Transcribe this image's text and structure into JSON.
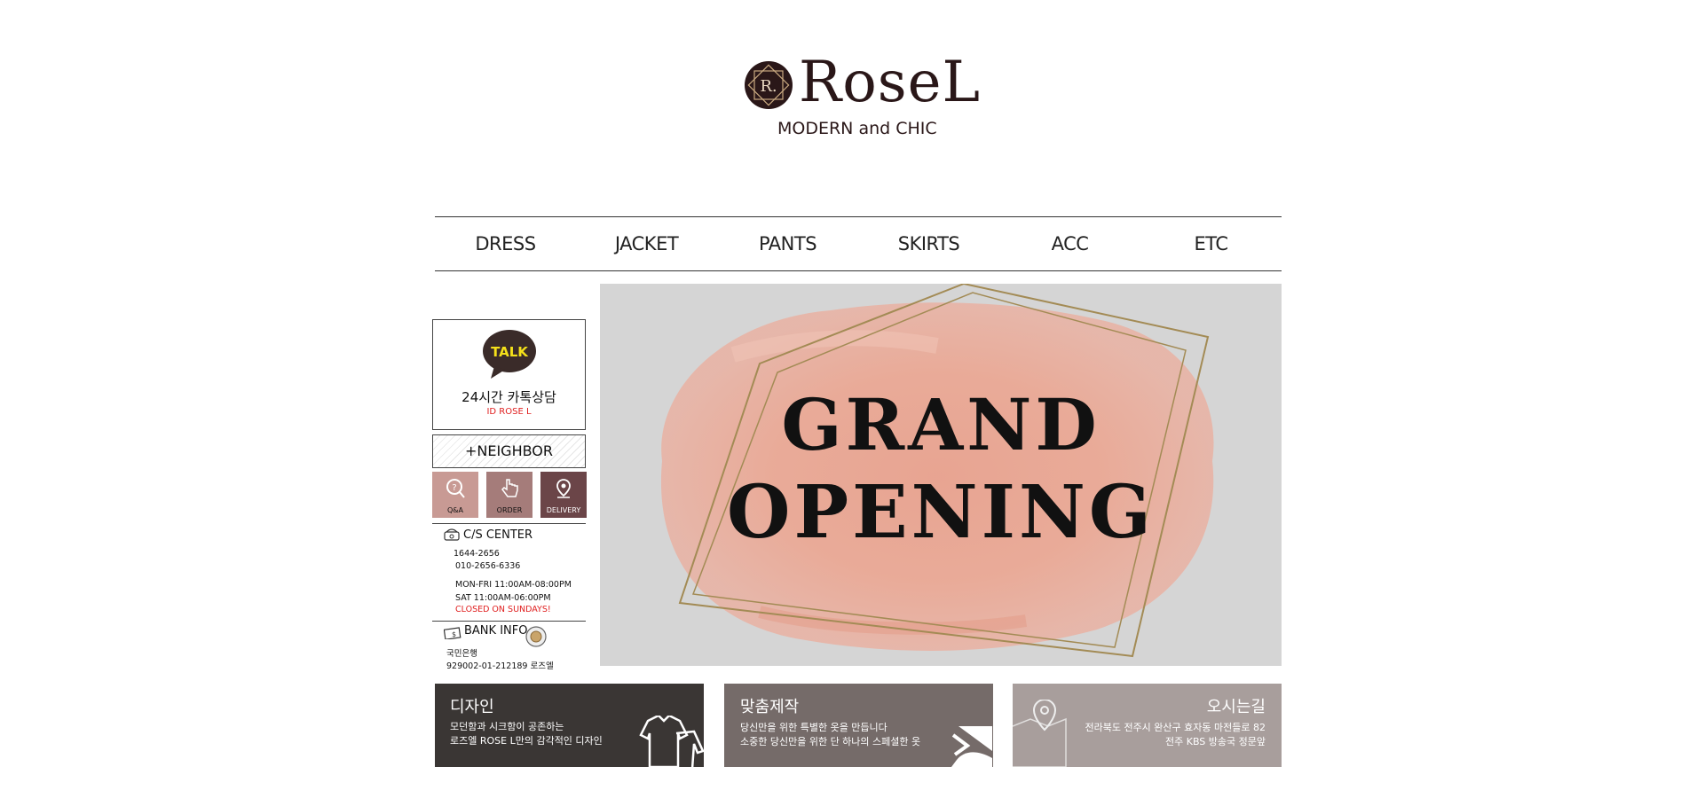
{
  "brand": {
    "logo_mark": "R.",
    "name": "RoseL",
    "tagline": "MODERN and CHIC"
  },
  "nav": [
    {
      "label": "DRESS"
    },
    {
      "label": "JACKET"
    },
    {
      "label": "PANTS"
    },
    {
      "label": "SKIRTS"
    },
    {
      "label": "ACC"
    },
    {
      "label": "ETC"
    }
  ],
  "talk": {
    "badge": "TALK",
    "title": "24시간 카톡상담",
    "id": "ID ROSE L"
  },
  "neighbor": {
    "label": "+NEIGHBOR"
  },
  "quick_buttons": [
    {
      "label": "Q&A",
      "color": "#c89a94"
    },
    {
      "label": "ORDER",
      "color": "#a57c7a"
    },
    {
      "label": "DELIVERY",
      "color": "#6b4548"
    }
  ],
  "cs": {
    "title": "C/S CENTER",
    "phone1": "1644-2656",
    "phone2": "010-2656-6336",
    "hours1": "MON-FRI 11:00AM-08:00PM",
    "hours2": "SAT 11:00AM-06:00PM",
    "closed": "CLOSED ON SUNDAYS!"
  },
  "bank": {
    "title": "BANK INFO",
    "bank_name": "국민은행",
    "account": "929002-01-212189 로즈엘"
  },
  "banner": {
    "line1": "GRAND",
    "line2": "OPENING"
  },
  "cards": [
    {
      "title": "디자인",
      "line1": "모던함과 시크함이 공존하는",
      "line2": "로즈엘 ROSE L만의 감각적인 디자인",
      "color": "#3a3634"
    },
    {
      "title": "맞춤제작",
      "line1": "당신만을 위한 특별한 옷을 만듭니다",
      "line2": "소중한 당신만을 위한 단 하나의 스페셜한 옷",
      "color": "#756b69"
    },
    {
      "title": "오시는길",
      "line1": "전라북도 전주시 완산구 효자동 마전들로 82",
      "line2": "전주 KBS 방송국 정문앞",
      "color": "#a89e9c"
    }
  ]
}
